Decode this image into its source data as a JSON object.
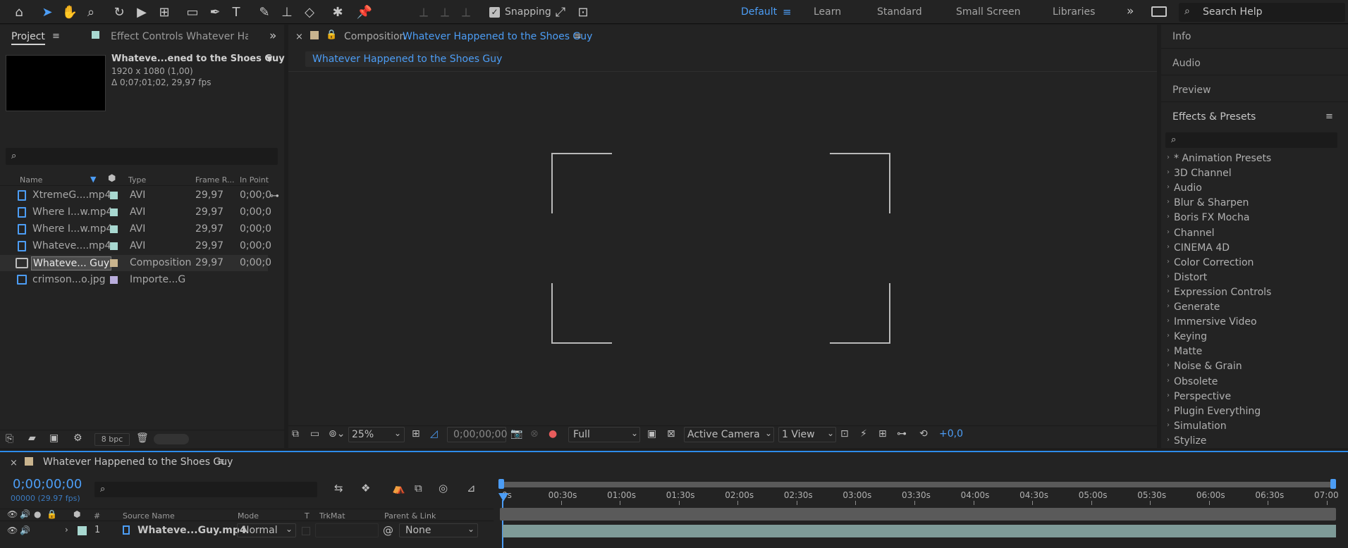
{
  "toolbar": {
    "snapping_label": "Snapping",
    "workspaces": [
      "Default",
      "Learn",
      "Standard",
      "Small Screen",
      "Libraries"
    ],
    "active_workspace": "Default",
    "search_placeholder": "Search Help"
  },
  "project_panel": {
    "tab_project": "Project",
    "tab_effect_controls": "Effect Controls Whatever Happe",
    "selected_name": "Whateve...ened to the Shoes Guy",
    "selected_resolution": "1920 x 1080 (1,00)",
    "selected_duration": "Δ 0;07;01;02, 29,97 fps",
    "columns": [
      "Name",
      "Type",
      "Frame R...",
      "In Point"
    ],
    "items": [
      {
        "name": "XtremeG....mp4",
        "type": "AVI",
        "frame_rate": "29,97",
        "in_point": "0;00;0",
        "label_color": "#a8d8d0",
        "kind": "video"
      },
      {
        "name": "Where I...w.mp4",
        "type": "AVI",
        "frame_rate": "29,97",
        "in_point": "0;00;0",
        "label_color": "#a8d8d0",
        "kind": "video"
      },
      {
        "name": "Where I...w.mp4",
        "type": "AVI",
        "frame_rate": "29,97",
        "in_point": "0;00;0",
        "label_color": "#a8d8d0",
        "kind": "video"
      },
      {
        "name": "Whateve....mp4",
        "type": "AVI",
        "frame_rate": "29,97",
        "in_point": "0;00;0",
        "label_color": "#a8d8d0",
        "kind": "video"
      },
      {
        "name": "Whateve... Guy",
        "type": "Composition",
        "frame_rate": "29,97",
        "in_point": "0;00;0",
        "label_color": "#c9b48e",
        "kind": "composition"
      },
      {
        "name": "crimson...o.jpg",
        "type": "Importe...G",
        "frame_rate": "",
        "in_point": "",
        "label_color": "#b9addc",
        "kind": "image"
      }
    ],
    "bpc": "8 bpc"
  },
  "viewer": {
    "tab_prefix": "Composition",
    "comp_name": "Whatever Happened to the Shoes Guy",
    "breadcrumb": "Whatever Happened to the Shoes Guy",
    "zoom": "25%",
    "timecode": "0;00;00;00",
    "resolution": "Full",
    "camera": "Active Camera",
    "views": "1 View",
    "exposure": "+0,0"
  },
  "right_panel": {
    "tabs": [
      "Info",
      "Audio",
      "Preview"
    ],
    "effects_title": "Effects & Presets",
    "effects": [
      "* Animation Presets",
      "3D Channel",
      "Audio",
      "Blur & Sharpen",
      "Boris FX Mocha",
      "Channel",
      "CINEMA 4D",
      "Color Correction",
      "Distort",
      "Expression Controls",
      "Generate",
      "Immersive Video",
      "Keying",
      "Matte",
      "Noise & Grain",
      "Obsolete",
      "Perspective",
      "Plugin Everything",
      "Simulation",
      "Stylize"
    ]
  },
  "timeline": {
    "comp_name": "Whatever Happened to the Shoes Guy",
    "timecode": "0;00;00;00",
    "frame_info": "00000 (29.97 fps)",
    "ticks": [
      "0s",
      "00:30s",
      "01:00s",
      "01:30s",
      "02:00s",
      "02:30s",
      "03:00s",
      "03:30s",
      "04:00s",
      "04:30s",
      "05:00s",
      "05:30s",
      "06:00s",
      "06:30s",
      "07:00"
    ],
    "headers": {
      "num": "#",
      "source": "Source Name",
      "mode": "Mode",
      "t": "T",
      "trkmat": "TrkMat",
      "parent": "Parent & Link"
    },
    "layer": {
      "index": "1",
      "name": "Whateve...Guy.mp4",
      "mode": "Normal",
      "parent": "None",
      "label_color": "#a8d8d0"
    }
  },
  "colors": {
    "accent": "#4c9df5",
    "panel": "#232323",
    "background": "#1d1d1d"
  }
}
